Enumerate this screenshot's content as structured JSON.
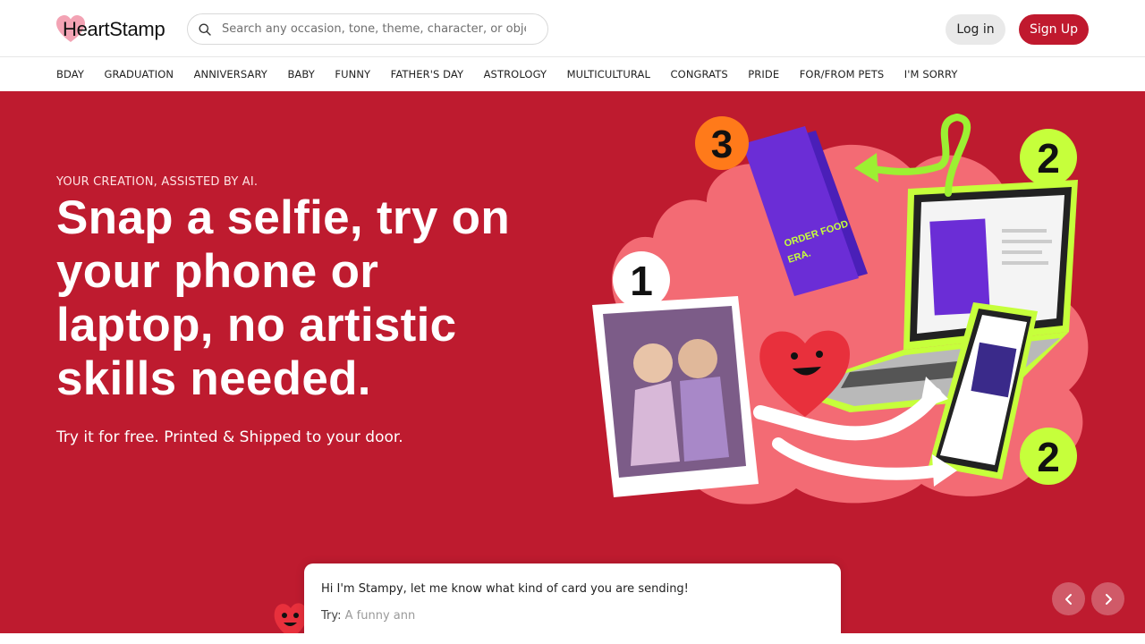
{
  "brand": {
    "name": "HeartStamp",
    "accent_color": "#be1b2f",
    "logo_heart_color": "#f3a3b4"
  },
  "search": {
    "placeholder": "Search any occasion, tone, theme, character, or object",
    "icon": "search-icon"
  },
  "header": {
    "login_label": "Log in",
    "signup_label": "Sign Up"
  },
  "nav": {
    "items": [
      "BDAY",
      "GRADUATION",
      "ANNIVERSARY",
      "BABY",
      "FUNNY",
      "FATHER'S DAY",
      "ASTROLOGY",
      "MULTICULTURAL",
      "CONGRATS",
      "PRIDE",
      "FOR/FROM PETS",
      "I'M SORRY"
    ]
  },
  "hero": {
    "eyebrow": "YOUR CREATION, ASSISTED BY AI.",
    "headline": "Snap a selfie, try on your phone or laptop, no artistic skills needed.",
    "subline": "Try it for free. Printed & Shipped to your door.",
    "illustration": {
      "step_numbers": [
        "1",
        "2",
        "3",
        "2"
      ],
      "card_text": "WE ARE OFFICIALLY IN OUR LETS JUST STAY IN AND ORDER FOOD ERA."
    }
  },
  "chat": {
    "message": "Hi I'm Stampy, let me know what kind of card you are sending!",
    "try_label": "Try:",
    "try_value": "A funny ann"
  },
  "carousel": {
    "prev_icon": "chevron-left-icon",
    "next_icon": "chevron-right-icon"
  }
}
